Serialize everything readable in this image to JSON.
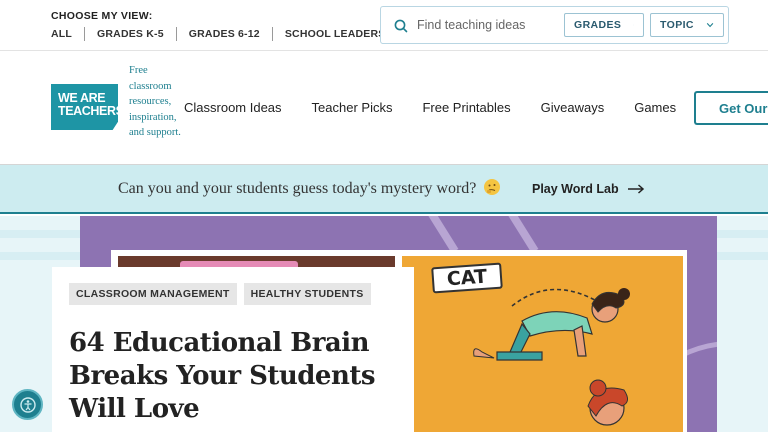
{
  "view_selector": {
    "title": "CHOOSE MY VIEW:",
    "links": [
      "ALL",
      "GRADES K-5",
      "GRADES 6-12",
      "SCHOOL LEADERS"
    ]
  },
  "search": {
    "placeholder": "Find teaching ideas",
    "filters": [
      "GRADES",
      "TOPIC"
    ]
  },
  "logo": {
    "text": "WE ARE TEACHERS"
  },
  "tagline": "Free classroom resources, inspiration, and support.",
  "nav": {
    "items": [
      "Classroom Ideas",
      "Teacher Picks",
      "Free Printables",
      "Giveaways",
      "Games"
    ],
    "cta_label": "Get Our Newsletters"
  },
  "banner": {
    "text": "Can you and your students guess today's mystery word?",
    "link_label": "Play Word Lab"
  },
  "hero": {
    "image_label": "CAT",
    "tags": [
      "CLASSROOM MANAGEMENT",
      "HEALTHY STUDENTS"
    ],
    "headline": "64 Educational Brain Breaks Your Students Will Love"
  },
  "colors": {
    "brand_teal": "#1e95a5",
    "banner_bg": "#cdecf0",
    "hero_purple": "#8d73b2",
    "illustration_orange": "#efa735"
  }
}
